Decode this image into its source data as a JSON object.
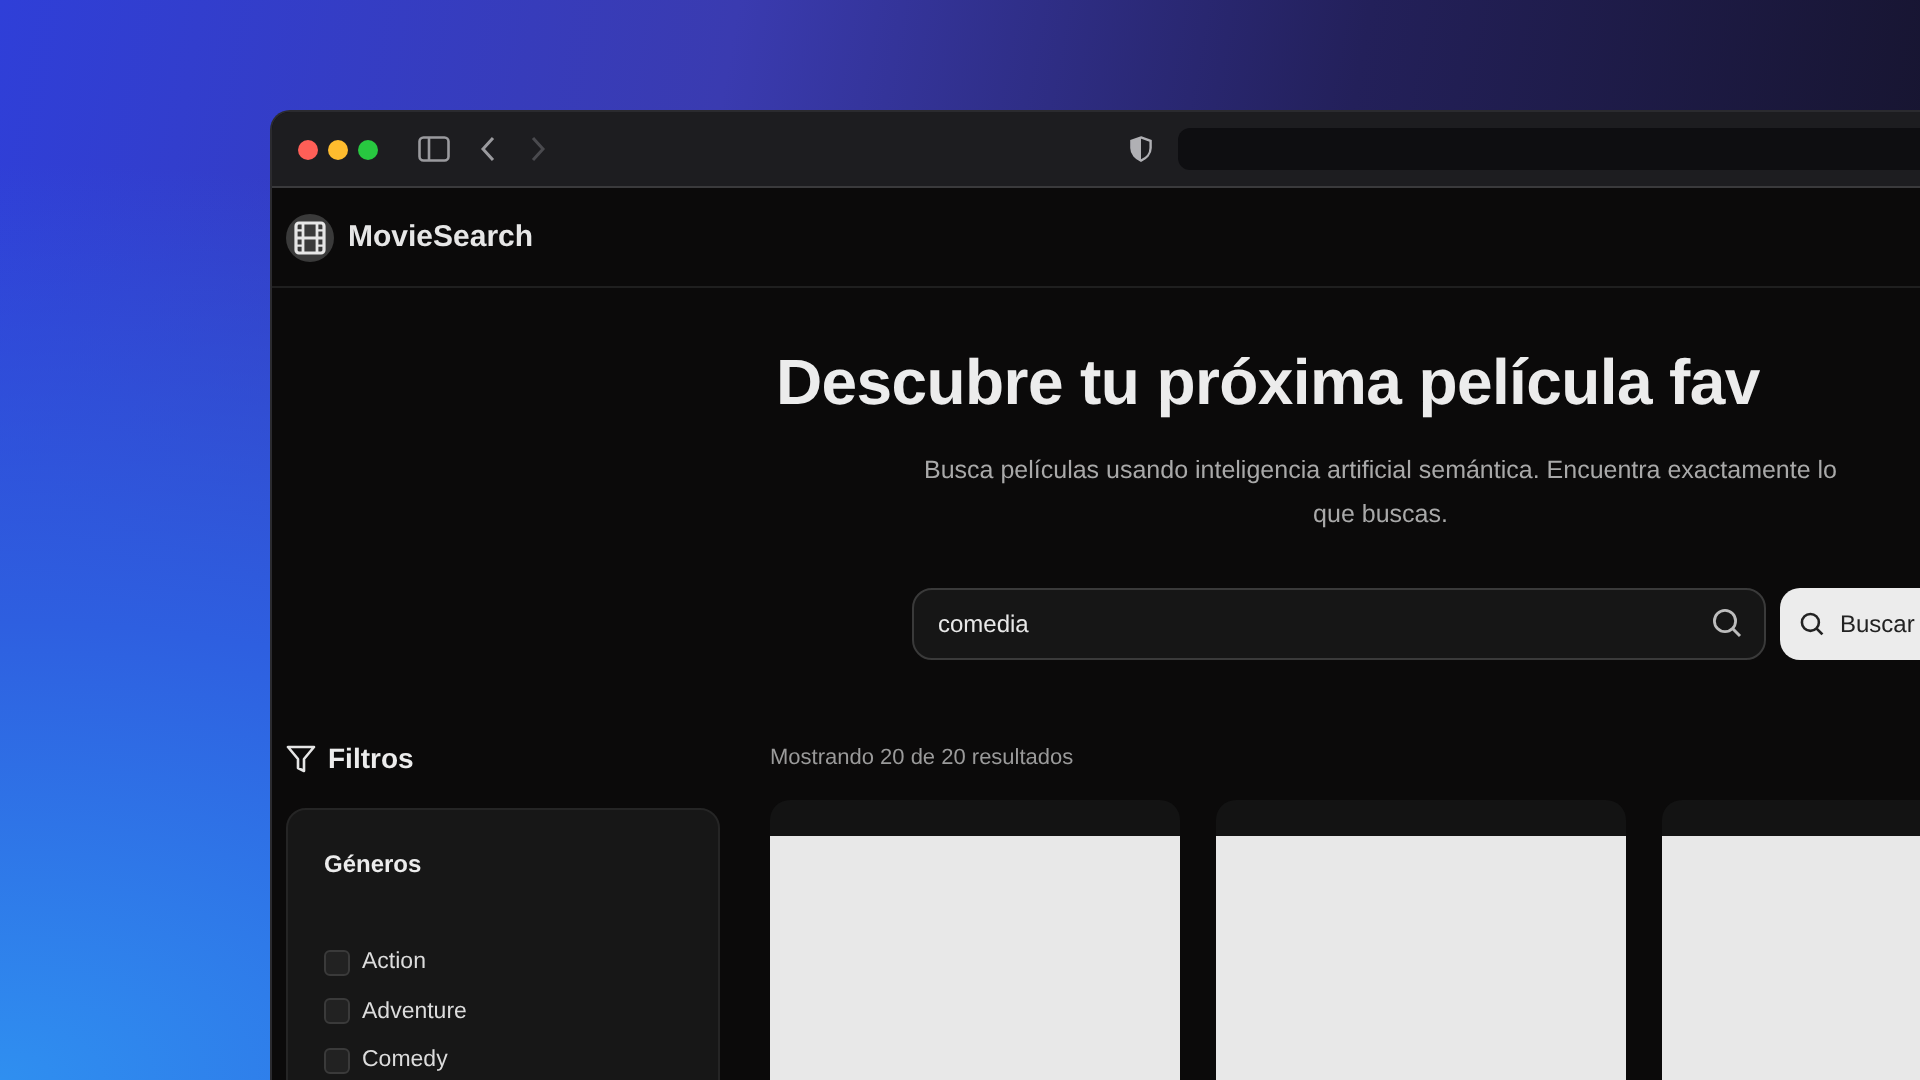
{
  "browser": {
    "back": {
      "disabled": false
    },
    "forward": {
      "disabled": true
    }
  },
  "app": {
    "name": "MovieSearch"
  },
  "hero": {
    "title": "Descubre tu próxima película fav",
    "subtitle_lines": [
      "Busca películas usando inteligencia artificial semántica. Encuentra exactamente lo",
      "que buscas."
    ]
  },
  "search": {
    "value": "comedia",
    "button": "Buscar"
  },
  "filters": {
    "title": "Filtros",
    "section": "Géneros",
    "genres": [
      {
        "label": "Action",
        "checked": false
      },
      {
        "label": "Adventure",
        "checked": false
      },
      {
        "label": "Comedy",
        "checked": false
      }
    ]
  },
  "results": {
    "summary": "Mostrando 20 de 20 resultados"
  }
}
